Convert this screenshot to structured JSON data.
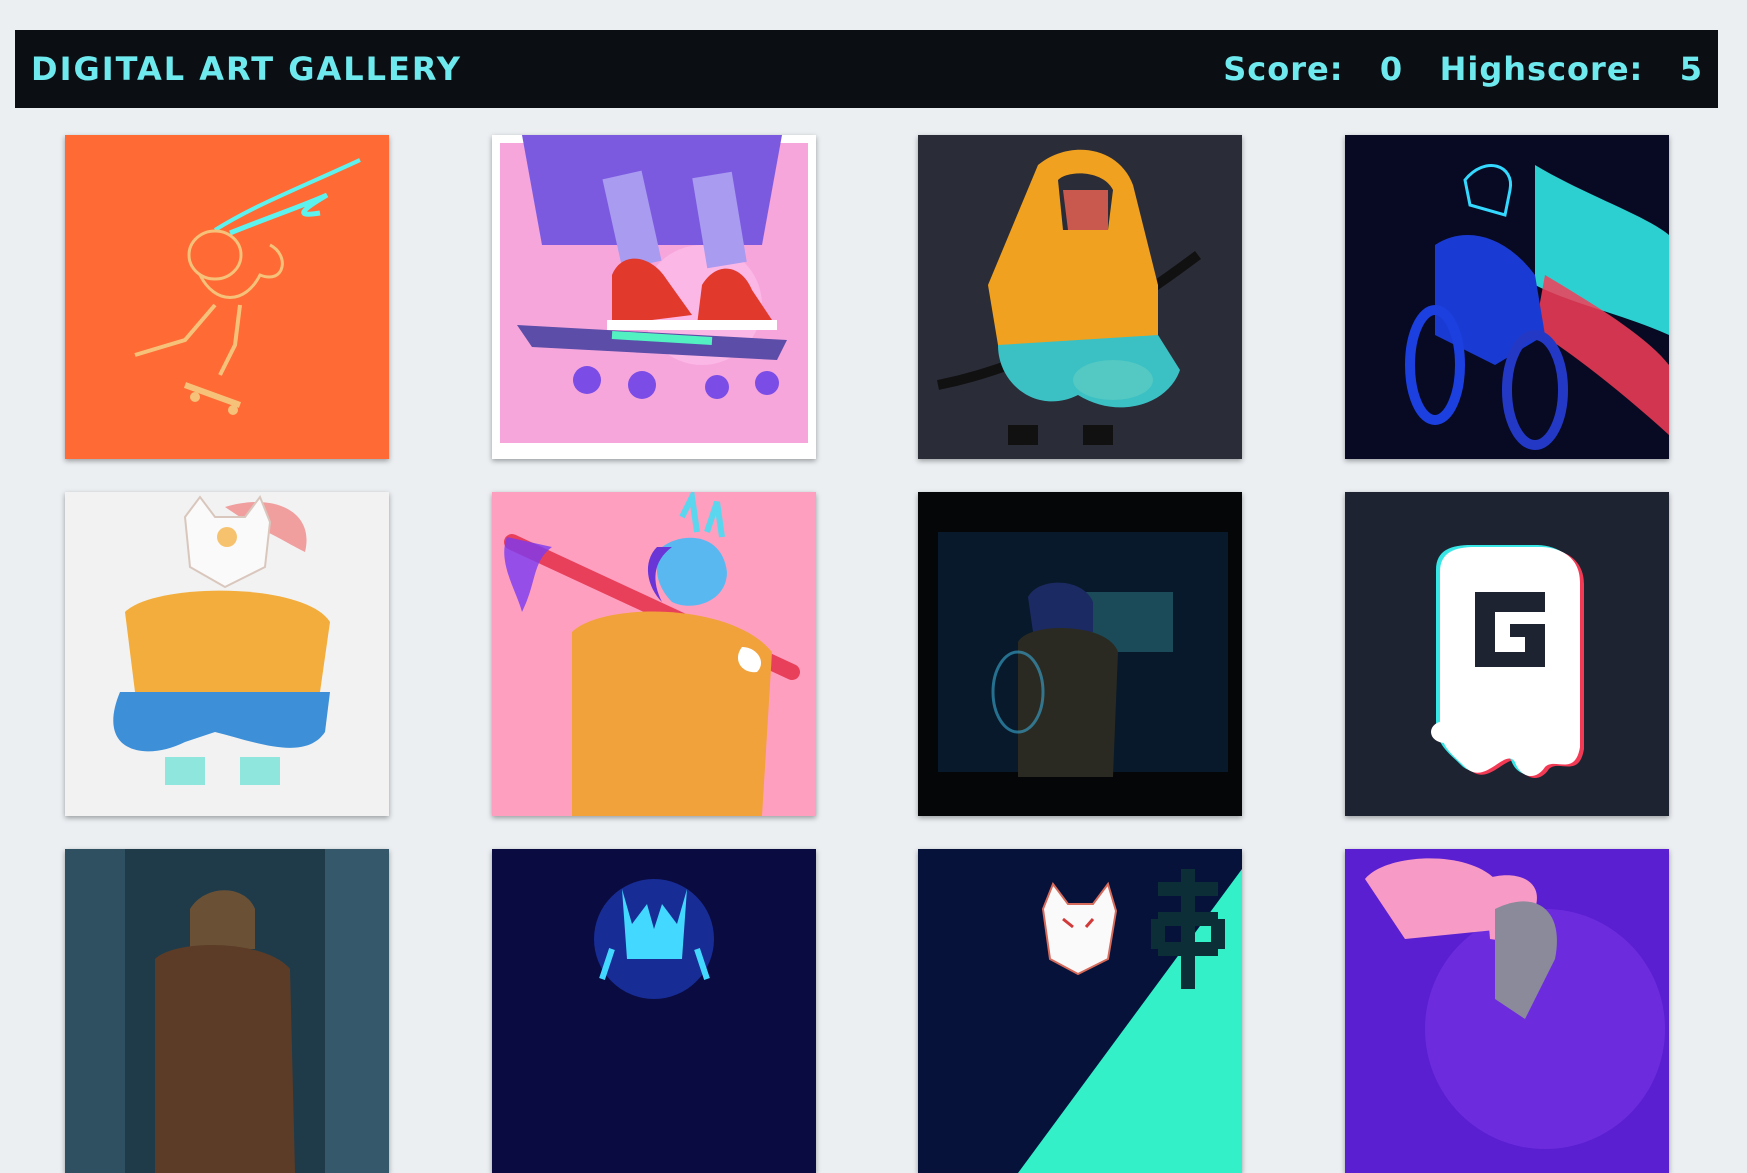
{
  "header": {
    "title": "DIGITAL ART GALLERY",
    "score_label": "Score:",
    "score_value": "0",
    "highscore_label": "Highscore:",
    "highscore_value": "5"
  },
  "colors": {
    "header_bg": "#0b0e13",
    "accent": "#6ee9ee",
    "page_bg": "#ebeff2"
  },
  "gallery": {
    "cards": [
      {
        "name": "skater-jump-orange",
        "bg": "#ff6a35"
      },
      {
        "name": "sneakers-skateboard-pink",
        "bg": "#f7a6dc"
      },
      {
        "name": "hoodie-katana-crouch",
        "bg": "#2a2c38"
      },
      {
        "name": "neon-motorbike-rider",
        "bg": "#070a22"
      },
      {
        "name": "kitsune-mask-crouch",
        "bg": "#f2f2f2"
      },
      {
        "name": "oni-mask-baseball-bat",
        "bg": "#ff9fc0"
      },
      {
        "name": "dark-alley-figure",
        "bg": "#050608"
      },
      {
        "name": "ghost-g-logo",
        "bg": "#1d2330"
      },
      {
        "name": "city-street-figure",
        "bg": "#1f3b4a"
      },
      {
        "name": "neon-oni-glow",
        "bg": "#0a0b40"
      },
      {
        "name": "kitsune-neon-kanji",
        "bg": "#06123a"
      },
      {
        "name": "purple-jump",
        "bg": "#5a1fd1"
      }
    ]
  }
}
